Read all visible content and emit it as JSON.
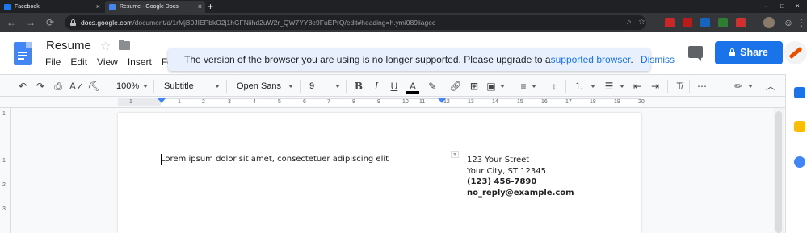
{
  "browser": {
    "tabs": [
      {
        "title": "Facebook",
        "active": false,
        "favicon_color": "#1877f2"
      },
      {
        "title": "Resume - Google Docs",
        "active": true,
        "favicon_color": "#4285f4"
      }
    ],
    "url_host": "docs.google.com",
    "url_path": "/document/d/1rMjB9JIEPbkO2j1hGFNiihd2uW2r_QW7YY8e9FuEPrQ/edit#heading=h.ymi089liagec",
    "nav": {
      "back": "←",
      "forward": "→",
      "reload": "⟳"
    },
    "window_controls": {
      "minimize": "–",
      "maximize": "□",
      "close": "×"
    }
  },
  "docs": {
    "title": "Resume",
    "menu": [
      "File",
      "Edit",
      "View",
      "Insert",
      "For"
    ],
    "notice": {
      "text": "The version of the browser you are using is no longer supported. Please upgrade to a",
      "link": "supported browser",
      "sep": ".",
      "dismiss": "Dismiss"
    },
    "share_label": "Share",
    "accent": "#1a73e8"
  },
  "toolbar": {
    "zoom": "100%",
    "style": "Subtitle",
    "font": "Open Sans",
    "size": "9",
    "bold": "B",
    "italic": "I",
    "underline": "U",
    "text_color": "A",
    "more": "⋯"
  },
  "ruler": {
    "labels": [
      "1",
      "1",
      "2",
      "3",
      "4",
      "5",
      "6",
      "7",
      "8",
      "9",
      "10",
      "11",
      "12",
      "13",
      "14",
      "15",
      "16",
      "17",
      "18",
      "19",
      "20"
    ]
  },
  "vruler": [
    "1",
    "1",
    "2",
    "3"
  ],
  "document": {
    "body": "Lorem ipsum dolor sit amet, consectetuer adipiscing elit",
    "address": {
      "street": "123 Your Street",
      "city": "Your City, ST 12345",
      "phone": "(123) 456-7890",
      "email": "no_reply@example.com"
    }
  }
}
